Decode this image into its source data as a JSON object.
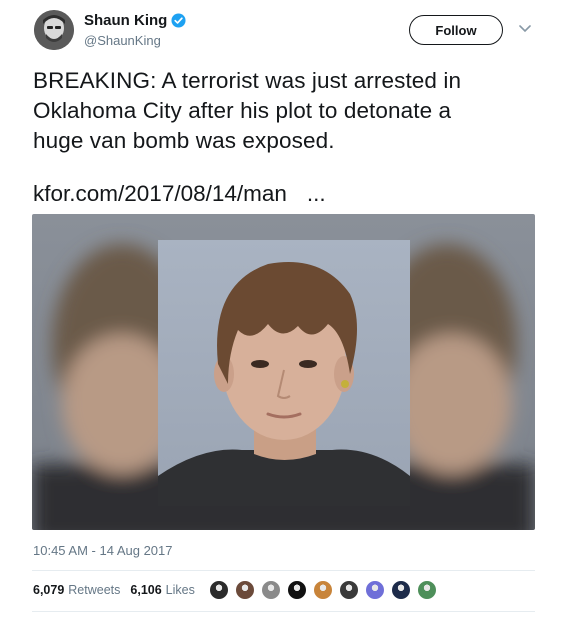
{
  "user": {
    "name": "Shaun King",
    "handle": "@ShaunKing",
    "verified": true
  },
  "follow_button": {
    "label": "Follow"
  },
  "tweet": {
    "lines": [
      "BREAKING: A terrorist was just arrested in",
      "Oklahoma City after his plot to detonate a",
      "huge van bomb was exposed."
    ],
    "link_text": "kfor.com/2017/08/14/man",
    "link_ellipsis": "..."
  },
  "timestamp": "10:45 AM - 14 Aug 2017",
  "stats": {
    "retweets_count": "6,079",
    "retweets_label": "Retweets",
    "likes_count": "6,106",
    "likes_label": "Likes"
  },
  "liker_colors": [
    "#2b2b2b",
    "#6b4a3a",
    "#8a8a8a",
    "#111111",
    "#c8843a",
    "#3a3a3a",
    "#6f6fd8",
    "#1d2b4a",
    "#4e8f5a"
  ],
  "colors": {
    "text": "#14171a",
    "secondary": "#657786",
    "verified": "#1da1f2",
    "divider": "#e6ecf0"
  }
}
